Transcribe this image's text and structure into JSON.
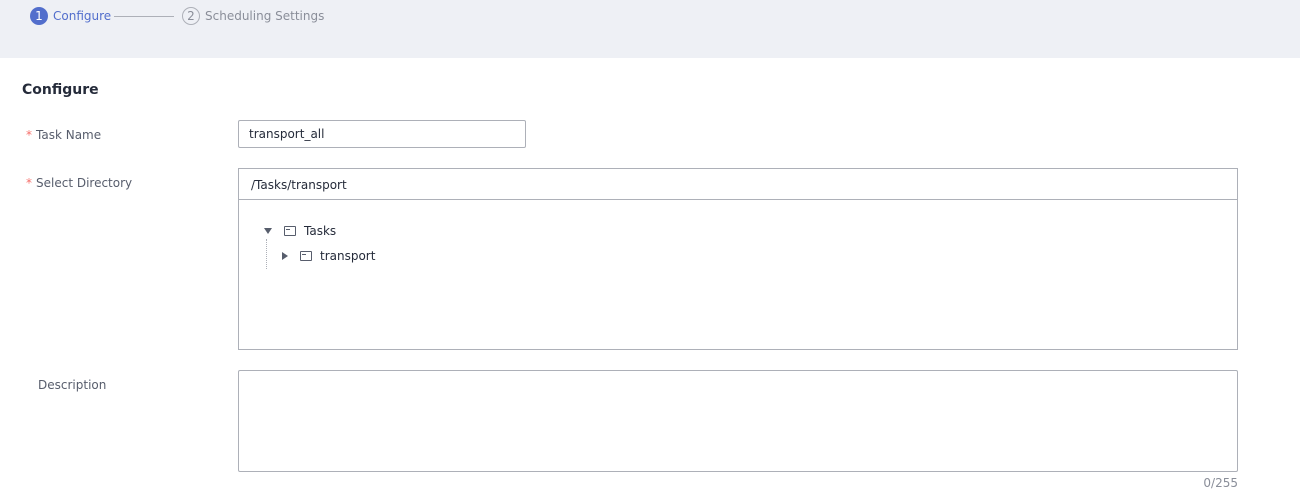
{
  "steps": [
    {
      "number": "1",
      "label": "Configure",
      "state": "active"
    },
    {
      "number": "2",
      "label": "Scheduling Settings",
      "state": "inactive"
    }
  ],
  "section": {
    "title": "Configure"
  },
  "form": {
    "required_mark": "*",
    "task_name": {
      "label": "Task Name",
      "value": "transport_all"
    },
    "directory": {
      "label": "Select Directory",
      "selected_path": "/Tasks/transport",
      "tree": [
        {
          "label": "Tasks",
          "expanded": true,
          "icon": "folder-icon",
          "children": [
            {
              "label": "transport",
              "expanded": false,
              "icon": "folder-icon"
            }
          ]
        }
      ]
    },
    "description": {
      "label": "Description",
      "value": "",
      "counter": "0/255"
    }
  },
  "colors": {
    "accent": "#526ecc",
    "required": "#f66f6a",
    "stepbar_bg": "#eef0f5",
    "border": "#adb0b8"
  }
}
